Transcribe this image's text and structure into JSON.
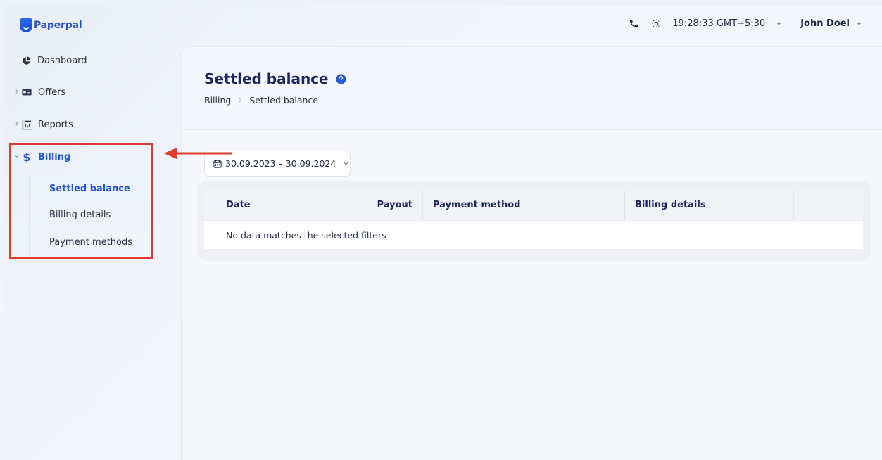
{
  "app": {
    "logo_text": "Paperpal"
  },
  "header": {
    "time": "19:28:33 GMT+5:30",
    "user_name": "John Doel"
  },
  "sidebar": {
    "items": [
      {
        "label": "Dashboard",
        "icon": "pie-chart-icon"
      },
      {
        "label": "Offers",
        "icon": "id-card-icon"
      },
      {
        "label": "Reports",
        "icon": "bar-chart-icon"
      },
      {
        "label": "Billing",
        "icon": "dollar-icon"
      }
    ],
    "billing_subitems": [
      {
        "label": "Settled balance",
        "active": true
      },
      {
        "label": "Billing details",
        "active": false
      },
      {
        "label": "Payment methods",
        "active": false
      }
    ]
  },
  "main": {
    "title": "Settled balance",
    "breadcrumb": [
      "Billing",
      "Settled balance"
    ],
    "date_range": "30.09.2023 – 30.09.2024",
    "table": {
      "columns": [
        "Date",
        "Payout",
        "Payment method",
        "Billing details"
      ],
      "empty_message": "No data matches the selected filters"
    }
  },
  "colors": {
    "accent": "#2558d6",
    "title": "#1b2560",
    "annotation": "#e23b2e"
  }
}
